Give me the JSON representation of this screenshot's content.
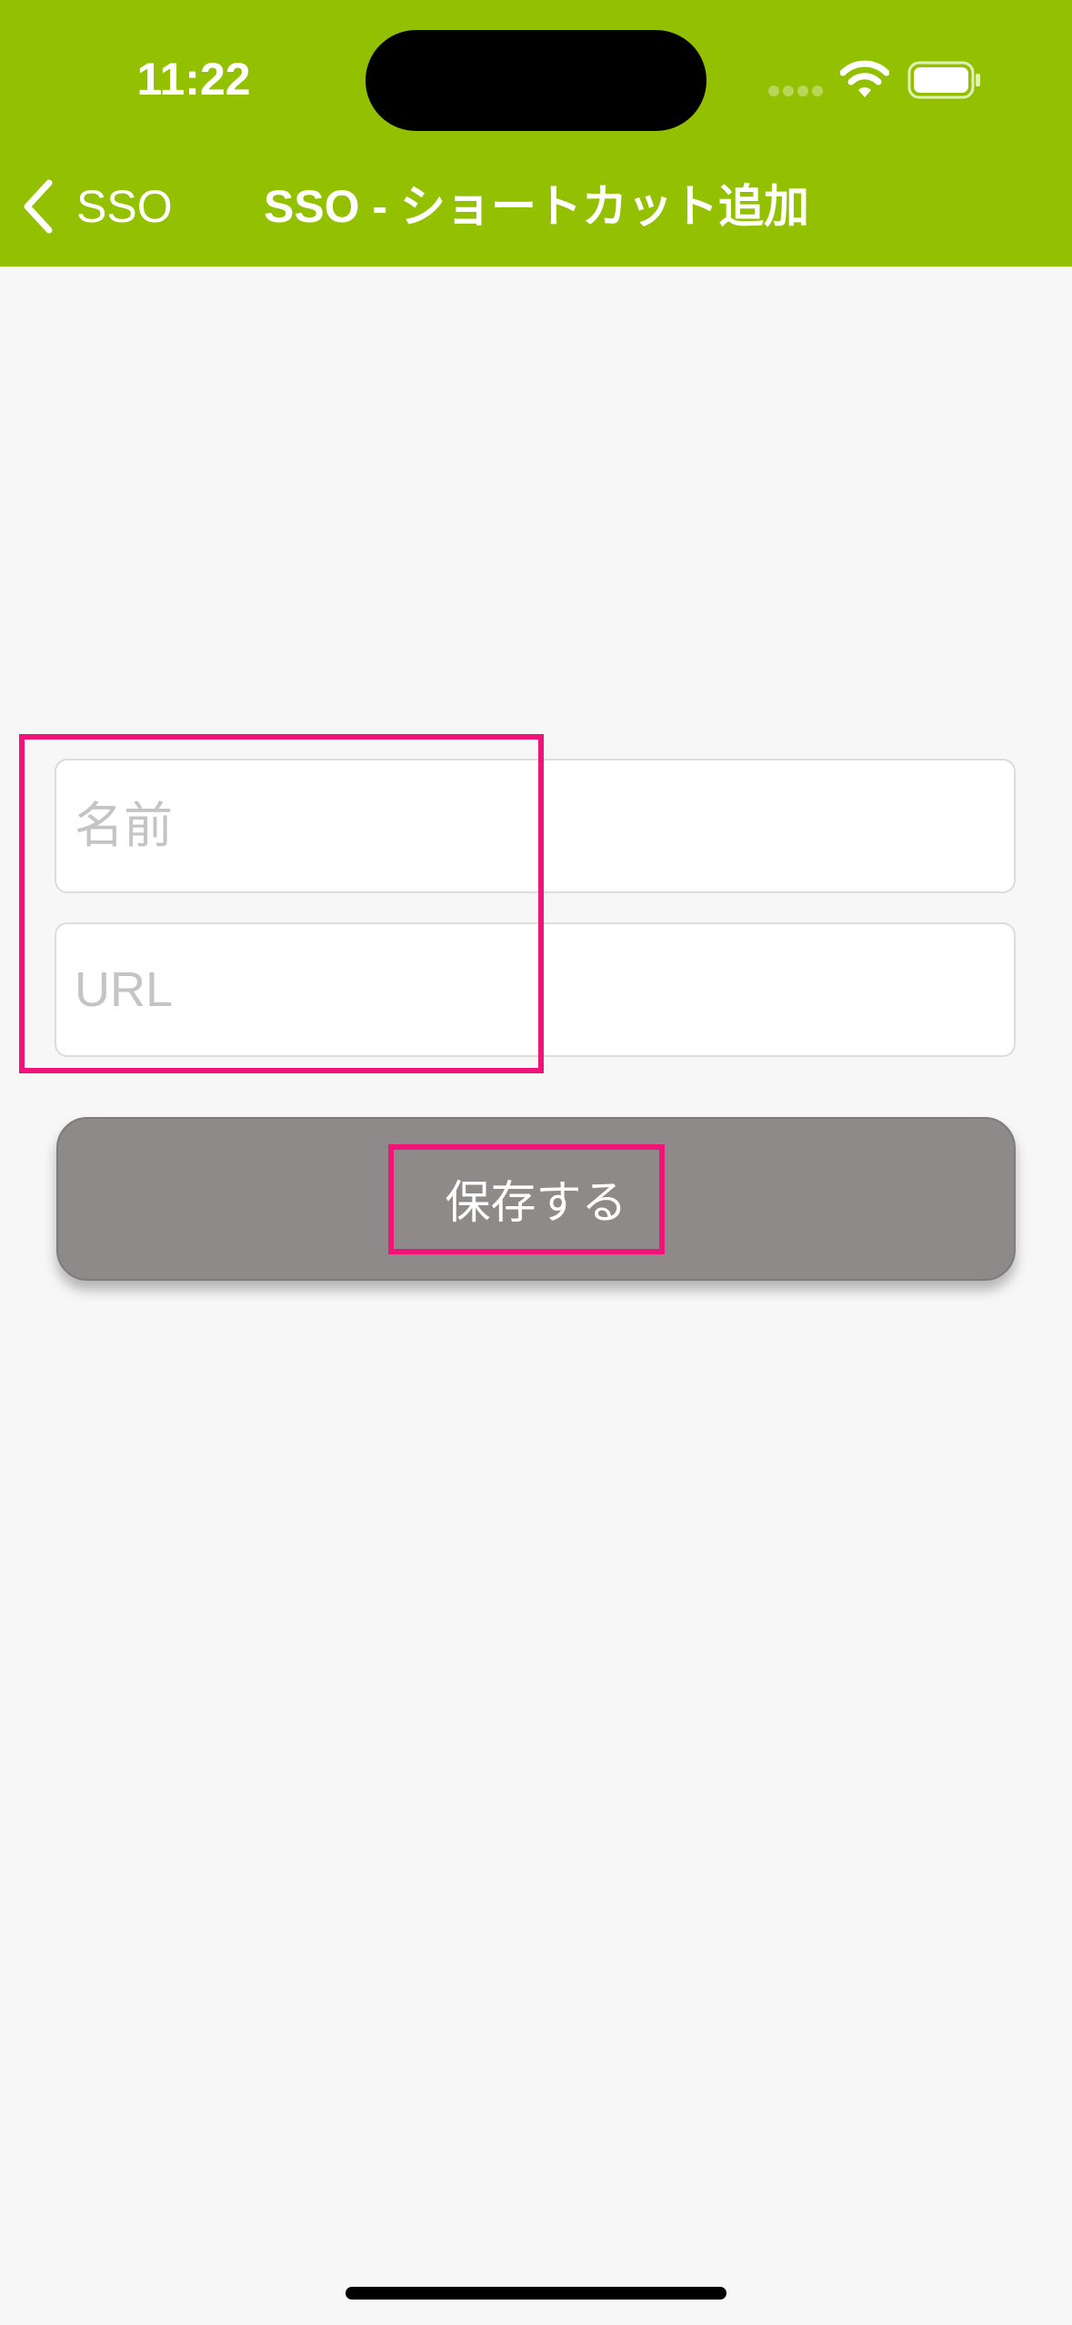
{
  "status_bar": {
    "time": "11:22",
    "icons": [
      "cellular-signal-icon",
      "wifi-icon",
      "battery-icon"
    ]
  },
  "nav": {
    "back_label": "SSO",
    "back_icon": "chevron-left-icon",
    "title": "SSO - ショートカット追加"
  },
  "form": {
    "name_placeholder": "名前",
    "name_value": "",
    "url_placeholder": "URL",
    "url_value": "",
    "save_label": "保存する"
  },
  "colors": {
    "header": "#93c000",
    "background": "#f7f7f7",
    "save_button": "#8e8a89",
    "highlight": "#f0137a"
  }
}
